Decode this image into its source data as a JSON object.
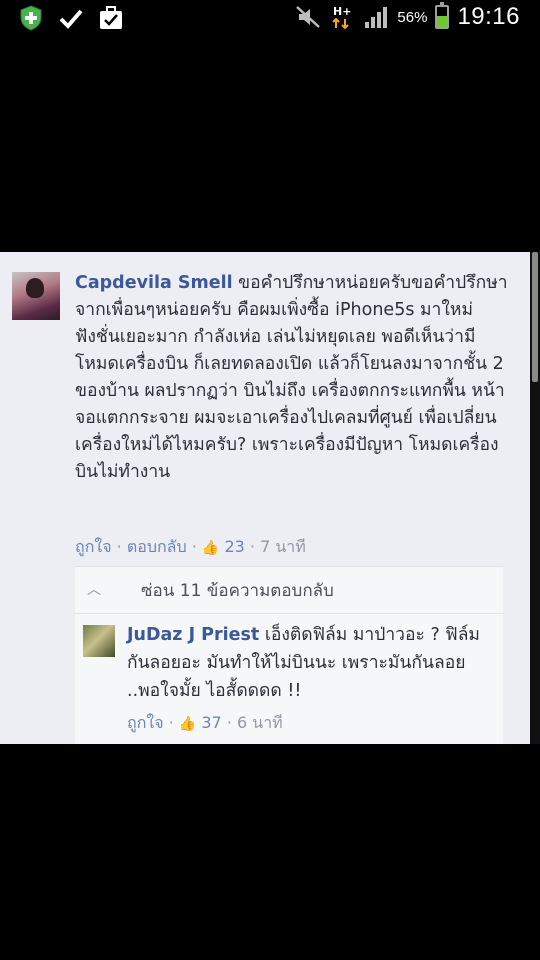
{
  "status_bar": {
    "left_icons": [
      "shield-plus-icon",
      "check-icon",
      "briefcase-check-icon"
    ],
    "right_icons": [
      "mute-icon",
      "hspa-plus-data-icon",
      "signal-bars-icon",
      "battery-icon"
    ],
    "network": "H+",
    "battery_percent": "56%",
    "battery_level": 0.56,
    "time": "19:16"
  },
  "post": {
    "main_comment": {
      "author": "Capdevila Smell",
      "text": "ขอคำปรึกษาหน่อยครับขอคำปรึกษาจากเพื่อนๆหน่อยครับ คือผมเพิ่งซื้อ iPhone5s มาใหม่ ฟังชั่นเยอะมาก กำลังเห่อ เล่นไม่หยุดเลย พอดีเห็นว่ามีโหมดเครื่องบิน ก็เลยทดลองเปิด แล้วก็โยนลงมาจากชั้น 2 ของบ้าน ผลปรากฏว่า บินไม่ถึง เครื่องตกกระแทกพื้น หน้าจอแตกกระจาย ผมจะเอาเครื่องไปเคลมที่ศูนย์ เพื่อเปลี่ยนเครื่องใหม่ได้ไหมครับ? เพราะเครื่องมีปัญหา โหมดเครื่องบินไม่ทำงาน",
      "like_label": "ถูกใจ",
      "reply_label": "ตอบกลับ",
      "like_count": "23",
      "time": "7 นาที"
    },
    "hide_replies_label": "ซ่อน 11 ข้อความตอบกลับ",
    "reply_comment": {
      "author": "JuDaz J Priest",
      "text": "เอ็งติดฟิล์ม มาป่าวอะ ? ฟิล์มกันลอยอะ มันทำให้ไม่บินนะ เพราะมันกันลอย ..พอใจมั้ย ไอสั้ดดดด !!",
      "like_label": "ถูกใจ",
      "like_count": "37",
      "time": "6 นาที"
    }
  }
}
